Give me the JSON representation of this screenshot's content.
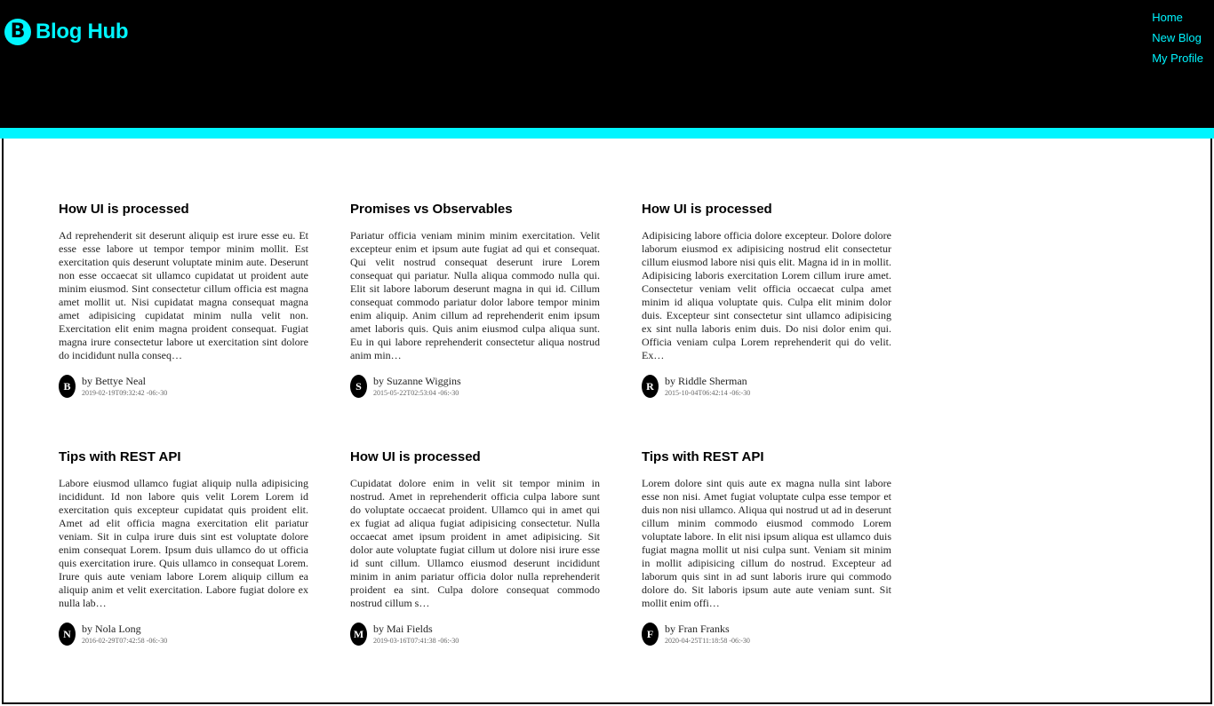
{
  "header": {
    "brand_icon_letter": "B",
    "brand_name": "Blog Hub",
    "nav": [
      "Home",
      "New Blog",
      "My Profile"
    ]
  },
  "colors": {
    "accent": "#00f5ff",
    "header_bg": "#000000"
  },
  "posts": [
    {
      "title": "How UI is processed",
      "body": "Ad reprehenderit sit deserunt aliquip est irure esse eu. Et esse esse labore ut tempor tempor minim mollit. Est exercitation quis deserunt voluptate minim aute. Deserunt non esse occaecat sit ullamco cupidatat ut proident aute minim eiusmod. Sint consectetur cillum officia est magna amet mollit ut. Nisi cupidatat magna consequat magna amet adipisicing cupidatat minim nulla velit non. Exercitation elit enim magna proident consequat. Fugiat magna irure consectetur labore ut exercitation sint dolore do incididunt nulla conseq…",
      "author_initial": "B",
      "author": "by Bettye Neal",
      "date": "2019-02-19T09:32:42 -06:-30"
    },
    {
      "title": "Promises vs Observables",
      "body": "Pariatur officia veniam minim minim exercitation. Velit excepteur enim et ipsum aute fugiat ad qui et consequat. Qui velit nostrud consequat deserunt irure Lorem consequat qui pariatur. Nulla aliqua commodo nulla qui. Elit sit labore laborum deserunt magna in qui id. Cillum consequat commodo pariatur dolor labore tempor minim enim aliquip. Anim cillum ad reprehenderit enim ipsum amet laboris quis. Quis anim eiusmod culpa aliqua sunt. Eu in qui labore reprehenderit consectetur aliqua nostrud anim min…",
      "author_initial": "S",
      "author": "by Suzanne Wiggins",
      "date": "2015-05-22T02:53:04 -06:-30"
    },
    {
      "title": "How UI is processed",
      "body": "Adipisicing labore officia dolore excepteur. Dolore dolore laborum eiusmod ex adipisicing nostrud elit consectetur cillum eiusmod labore nisi quis elit. Magna id in in mollit. Adipisicing laboris exercitation Lorem cillum irure amet. Consectetur veniam velit officia occaecat culpa amet minim id aliqua voluptate quis. Culpa elit minim dolor duis. Excepteur sint consectetur sint ullamco adipisicing ex sint nulla laboris enim duis. Do nisi dolor enim qui. Officia veniam culpa Lorem reprehenderit qui do velit. Ex…",
      "author_initial": "R",
      "author": "by Riddle Sherman",
      "date": "2015-10-04T06:42:14 -06:-30"
    },
    {
      "title": "Tips with REST API",
      "body": "Labore eiusmod ullamco fugiat aliquip nulla adipisicing incididunt. Id non labore quis velit Lorem Lorem id exercitation quis excepteur cupidatat quis proident elit. Amet ad elit officia magna exercitation elit pariatur veniam. Sit in culpa irure duis sint est voluptate dolore enim consequat Lorem. Ipsum duis ullamco do ut officia quis exercitation irure. Quis ullamco in consequat Lorem. Irure quis aute veniam labore Lorem aliquip cillum ea aliquip anim et velit exercitation. Labore fugiat dolore ex nulla lab…",
      "author_initial": "N",
      "author": "by Nola Long",
      "date": "2016-02-29T07:42:58 -06:-30"
    },
    {
      "title": "How UI is processed",
      "body": "Cupidatat dolore enim in velit sit tempor minim in nostrud. Amet in reprehenderit officia culpa labore sunt do voluptate occaecat proident. Ullamco qui in amet qui ex fugiat ad aliqua fugiat adipisicing consectetur. Nulla occaecat amet ipsum proident in amet adipisicing. Sit dolor aute voluptate fugiat cillum ut dolore nisi irure esse id sunt cillum. Ullamco eiusmod deserunt incididunt minim in anim pariatur officia dolor nulla reprehenderit proident ea sint. Culpa dolore consequat commodo nostrud cillum s…",
      "author_initial": "M",
      "author": "by Mai Fields",
      "date": "2019-03-16T07:41:38 -06:-30"
    },
    {
      "title": "Tips with REST API",
      "body": "Lorem dolore sint quis aute ex magna nulla sint labore esse non nisi. Amet fugiat voluptate culpa esse tempor et duis non nisi ullamco. Aliqua qui nostrud ut ad in deserunt cillum minim commodo eiusmod commodo Lorem voluptate labore. In elit nisi ipsum aliqua est ullamco duis fugiat magna mollit ut nisi culpa sunt. Veniam sit minim in mollit adipisicing cillum do nostrud. Excepteur ad laborum quis sint in ad sunt laboris irure qui commodo dolore do. Sit laboris ipsum aute aute veniam sunt. Sit mollit enim offi…",
      "author_initial": "F",
      "author": "by Fran Franks",
      "date": "2020-04-25T11:18:58 -06:-30"
    }
  ]
}
